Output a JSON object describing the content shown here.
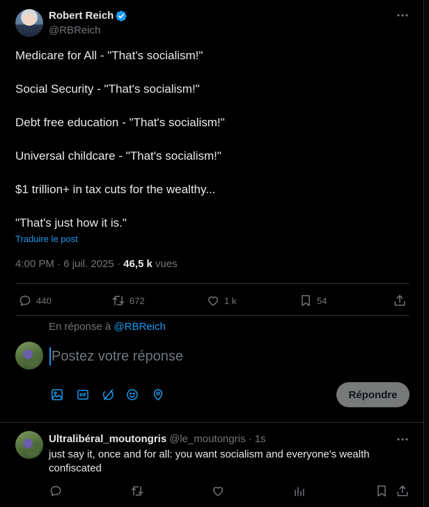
{
  "tweet": {
    "author_name": "Robert Reich",
    "author_handle": "@RBReich",
    "lines": [
      "Medicare for All - \"That's socialism!\"",
      "Social Security - \"That's socialism!\"",
      "Debt free education - \"That's socialism!\"",
      "Universal childcare - \"That's socialism!\"",
      "$1 trillion+ in tax cuts for the wealthy...",
      "\"That's just how it is.\""
    ],
    "translate_label": "Traduire le post",
    "time": "4:00 PM",
    "date": "6 juil. 2025",
    "separator": "·",
    "views_count": "46,5 k",
    "views_label": "vues",
    "stats": {
      "replies": "440",
      "reposts": "672",
      "likes": "1 k",
      "bookmarks": "54"
    }
  },
  "composer": {
    "replying_prefix": "En réponse à",
    "replying_to": "@RBReich",
    "placeholder": "Postez votre réponse",
    "submit_label": "Répondre"
  },
  "reply": {
    "author_name": "Ultralibéral_moutongris",
    "author_handle": "@le_moutongris",
    "age": "1s",
    "text": "just say it, once and for all: you want socialism and everyone's wealth confiscated"
  },
  "icons": {
    "verified": "verified-badge-icon",
    "more": "more-icon",
    "reply": "reply-icon",
    "repost": "repost-icon",
    "like": "heart-icon",
    "bookmark": "bookmark-icon",
    "share": "share-icon",
    "views": "views-icon",
    "media": "image-icon",
    "gif": "gif-icon",
    "grok": "grok-icon",
    "emoji": "emoji-icon",
    "location": "location-icon"
  },
  "colors": {
    "background": "#000000",
    "text": "#e7e9ea",
    "secondary": "#71767b",
    "accent": "#1d9bf0",
    "border": "#2f3336",
    "button_disabled": "#787a7a"
  }
}
